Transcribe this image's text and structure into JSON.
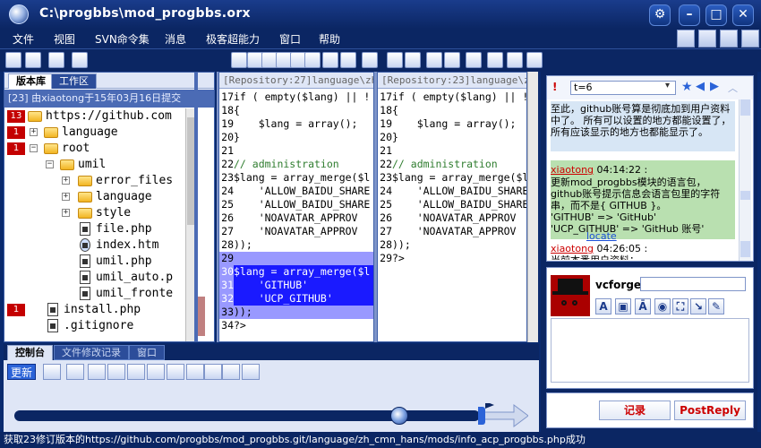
{
  "window": {
    "title": "C:\\progbbs\\mod_progbbs.orx"
  },
  "menu": [
    "文件",
    "视图",
    "SVN命令集",
    "消息",
    "极客超能力",
    "窗口",
    "帮助"
  ],
  "left_panel": {
    "tabs": [
      "版本库",
      "工作区"
    ],
    "commit_info": "[23] 由xiaotong于15年03月16日提交",
    "tree": [
      {
        "badge": "13",
        "label": "https://github.com",
        "type": "folder"
      },
      {
        "badge": "1",
        "label": "language",
        "type": "folder"
      },
      {
        "badge": "1",
        "label": "root",
        "type": "folder"
      },
      {
        "badge": "",
        "label": "umil",
        "type": "folder"
      },
      {
        "badge": "",
        "label": "error_files",
        "type": "folder"
      },
      {
        "badge": "",
        "label": "language",
        "type": "folder"
      },
      {
        "badge": "",
        "label": "style",
        "type": "folder"
      },
      {
        "badge": "",
        "label": "file.php",
        "type": "file"
      },
      {
        "badge": "",
        "label": "index.htm",
        "type": "file"
      },
      {
        "badge": "",
        "label": "umil.php",
        "type": "file"
      },
      {
        "badge": "",
        "label": "umil_auto.p",
        "type": "file"
      },
      {
        "badge": "",
        "label": "umil_fronte",
        "type": "file"
      },
      {
        "badge": "1",
        "label": "install.php",
        "type": "file"
      },
      {
        "badge": "",
        "label": ".gitignore",
        "type": "file"
      }
    ]
  },
  "code_left": {
    "header": "[Repository:27]language\\zh_cmn_",
    "lines": [
      {
        "n": "17",
        "t": "if ( empty($lang) || !"
      },
      {
        "n": "18",
        "t": "{"
      },
      {
        "n": "19",
        "t": "    $lang = array();"
      },
      {
        "n": "20",
        "t": "}"
      },
      {
        "n": "21",
        "t": ""
      },
      {
        "n": "22",
        "t": "// administration"
      },
      {
        "n": "23",
        "t": "$lang = array_merge($l"
      },
      {
        "n": "24",
        "t": "    'ALLOW_BAIDU_SHARE"
      },
      {
        "n": "25",
        "t": "    'ALLOW_BAIDU_SHARE"
      },
      {
        "n": "26",
        "t": "    'NOAVATAR_APPROV"
      },
      {
        "n": "27",
        "t": "    'NOAVATAR_APPROV"
      },
      {
        "n": "28",
        "t": "));"
      },
      {
        "n": "29",
        "t": ""
      },
      {
        "n": "30",
        "t": "$lang = array_merge($l"
      },
      {
        "n": "31",
        "t": "    'GITHUB'"
      },
      {
        "n": "32",
        "t": "    'UCP_GITHUB'"
      },
      {
        "n": "33",
        "t": "));"
      },
      {
        "n": "34",
        "t": "?>"
      }
    ]
  },
  "code_right": {
    "header": "[Repository:23]language\\zh_cmn_",
    "lines": [
      {
        "n": "17",
        "t": "if ( empty($lang) || !"
      },
      {
        "n": "18",
        "t": "{"
      },
      {
        "n": "19",
        "t": "    $lang = array();"
      },
      {
        "n": "20",
        "t": "}"
      },
      {
        "n": "21",
        "t": ""
      },
      {
        "n": "22",
        "t": "// administration"
      },
      {
        "n": "23",
        "t": "$lang = array_merge($l"
      },
      {
        "n": "24",
        "t": "    'ALLOW_BAIDU_SHARE"
      },
      {
        "n": "25",
        "t": "    'ALLOW_BAIDU_SHARE"
      },
      {
        "n": "26",
        "t": "    'NOAVATAR_APPROV"
      },
      {
        "n": "27",
        "t": "    'NOAVATAR_APPROV"
      },
      {
        "n": "28",
        "t": "));"
      },
      {
        "n": "29",
        "t": "?>"
      }
    ]
  },
  "chat": {
    "selector_value": "t=6",
    "messages": [
      {
        "who": "",
        "time": "",
        "text": "至此，github账号算是彻底加到用户资料中了。\n所有可以设置的地方都能设置了，所有应该显示的地方也都能显示了。"
      },
      {
        "who": "xiaotong",
        "time": "04:14:22 :",
        "text": "更新mod_progbbs模块的语言包，github账号提示信息会语言包里的字符串，而不是{ GITHUB }。\n'GITHUB' => 'GitHub'\n'UCP_GITHUB' => 'GitHub 账号'",
        "link": "locate"
      },
      {
        "who": "xiaotong",
        "time": "04:26:05 :",
        "text": "当前本番用户资料："
      }
    ]
  },
  "profile": {
    "username": "vcforge",
    "input_value": ""
  },
  "actions": {
    "record": "记录",
    "post_reply": "PostReply"
  },
  "console": {
    "tabs": [
      "控制台",
      "文件修改记录",
      "窗口"
    ],
    "refresh": "更新"
  },
  "status": "获取23修订版本的https://github.com/progbbs/mod_progbbs.git/language/zh_cmn_hans/mods/info_acp_progbbs.php成功",
  "colors": {
    "frame": "#0b2663",
    "accent": "#2b63d8",
    "badge": "#c40000",
    "diff_highlight": "#1a1aff"
  }
}
